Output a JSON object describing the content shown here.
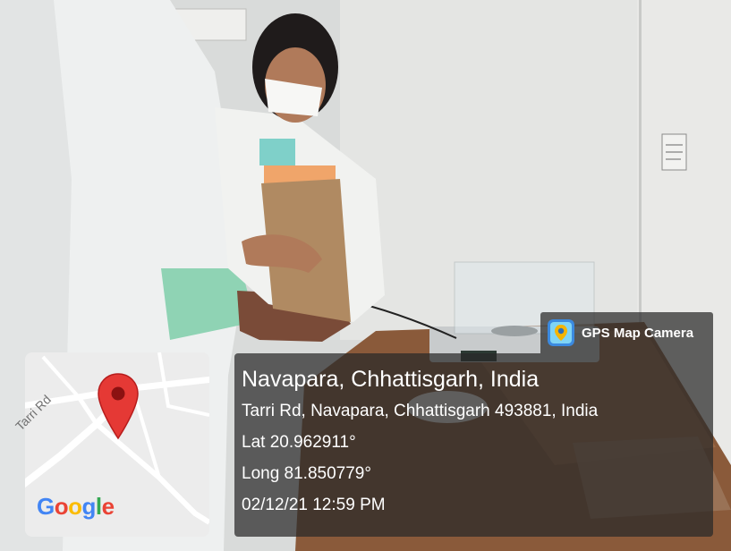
{
  "overlay": {
    "app_name": "GPS Map Camera",
    "app_icon": "gps-map-camera-app-icon",
    "place": "Navapara, Chhattisgarh, India",
    "address": "Tarri Rd, Navapara, Chhattisgarh 493881, India",
    "latitude": "Lat 20.962911°",
    "longitude": "Long 81.850779°",
    "datetime": "02/12/21 12:59 PM",
    "panel_color": "#282828"
  },
  "map": {
    "road_label": "Tarri Rd",
    "pin_icon": "map-pin-icon",
    "pin_color": "#e53935",
    "logo": "Google"
  }
}
